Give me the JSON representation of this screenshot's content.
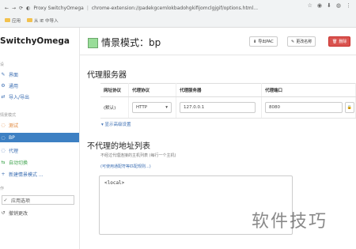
{
  "browser": {
    "tab_title": "Proxy SwitchyOmega",
    "url": "chrome-extension://padekgcemlokbadohgkifijomclgjgif/options.html...",
    "bookmarks": [
      "应用",
      "从 IE 中导入"
    ]
  },
  "sidebar": {
    "app_title": "SwitchyOmega",
    "settings_section": "设",
    "settings_items": [
      {
        "label": "界面",
        "icon": "brush-icon"
      },
      {
        "label": "通用",
        "icon": "gear-icon"
      },
      {
        "label": "导入/导出",
        "icon": "transfer-icon"
      }
    ],
    "profiles_section": "情景模式",
    "profile_items": [
      {
        "label": "测试",
        "icon": "globe-icon"
      },
      {
        "label": "BP",
        "icon": "globe-icon"
      },
      {
        "label": "代理",
        "icon": "globe-icon"
      },
      {
        "label": "自动切换",
        "icon": "retweet-icon"
      },
      {
        "label": "新建情景模式 ...",
        "icon": "plus-icon"
      }
    ],
    "actions_section": "作",
    "action_items": [
      {
        "label": "应用选项",
        "icon": "check-icon"
      },
      {
        "label": "撤销更改",
        "icon": "undo-icon"
      }
    ]
  },
  "main": {
    "profile_title": "情景模式：bp",
    "profile_color": "#99dd99",
    "buttons": {
      "export_pac": "导出PAC",
      "rename": "更改名称",
      "delete": "删除"
    },
    "proxy_servers": {
      "heading": "代理服务器",
      "columns": [
        "网址协议",
        "代理协议",
        "代理服务器",
        "代理端口"
      ],
      "row": {
        "scheme": "(默认)",
        "protocol": "HTTP",
        "server": "127.0.0.1",
        "port": "8080"
      },
      "show_advanced": "显示高级设置"
    },
    "bypass": {
      "heading": "不代理的地址列表",
      "note": "不经过代理连接的主机列表 (每行一个主机)",
      "wildcard_link": "(可使用通配符等匹配规则...)",
      "value": "<local>"
    }
  },
  "watermark": "软件技巧"
}
